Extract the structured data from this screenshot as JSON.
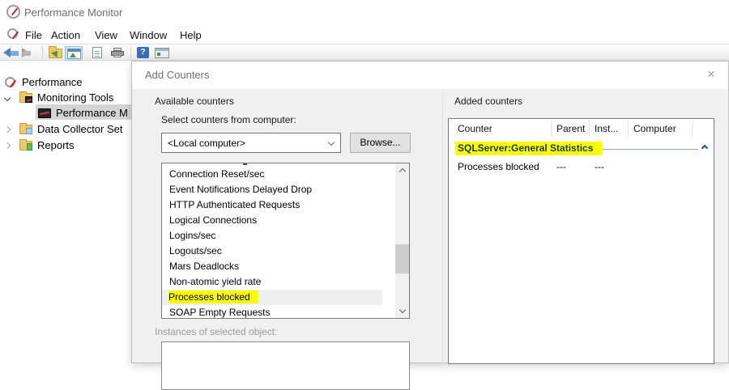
{
  "window": {
    "title": "Performance Monitor"
  },
  "menu": {
    "items": [
      "File",
      "Action",
      "View",
      "Window",
      "Help"
    ]
  },
  "toolbar": {
    "icons": [
      "back-icon",
      "forward-icon",
      "folder-up-icon",
      "performance-view-icon",
      "report-view-icon",
      "print-icon",
      "help-icon",
      "console-window-icon"
    ]
  },
  "tree": {
    "root": "Performance",
    "items": [
      {
        "label": "Monitoring Tools",
        "state": "expanded"
      },
      {
        "label": "Performance M",
        "state": "selected"
      },
      {
        "label": "Data Collector Set",
        "state": "collapsed"
      },
      {
        "label": "Reports",
        "state": "collapsed"
      }
    ]
  },
  "dialog": {
    "title": "Add Counters",
    "close_icon": "×",
    "available": {
      "section_label": "Available counters",
      "computer_label": "Select counters from computer:",
      "computer_value": "<Local computer>",
      "browse_label": "Browse...",
      "counters": [
        "Connection Reset/sec",
        "Event Notifications Delayed Drop",
        "HTTP Authenticated Requests",
        "Logical Connections",
        "Logins/sec",
        "Logouts/sec",
        "Mars Deadlocks",
        "Non-atomic yield rate",
        "Processes blocked",
        "SOAP Empty Requests"
      ],
      "highlighted_counter": "Processes blocked",
      "instances_label": "Instances of selected object:"
    },
    "added": {
      "section_label": "Added counters",
      "columns": [
        "Counter",
        "Parent",
        "Inst...",
        "Computer"
      ],
      "group_name": "SQLServer:General Statistics",
      "rows": [
        {
          "counter": "Processes blocked",
          "parent": "---",
          "instance": "---",
          "computer": ""
        }
      ]
    }
  },
  "colors": {
    "highlight_yellow": "#ffff00",
    "group_text_navy": "#17365d",
    "chevron_blue": "#2144a0",
    "dialog_body": "#f0f0f0",
    "selected_row_gray": "#d5d5d5"
  }
}
